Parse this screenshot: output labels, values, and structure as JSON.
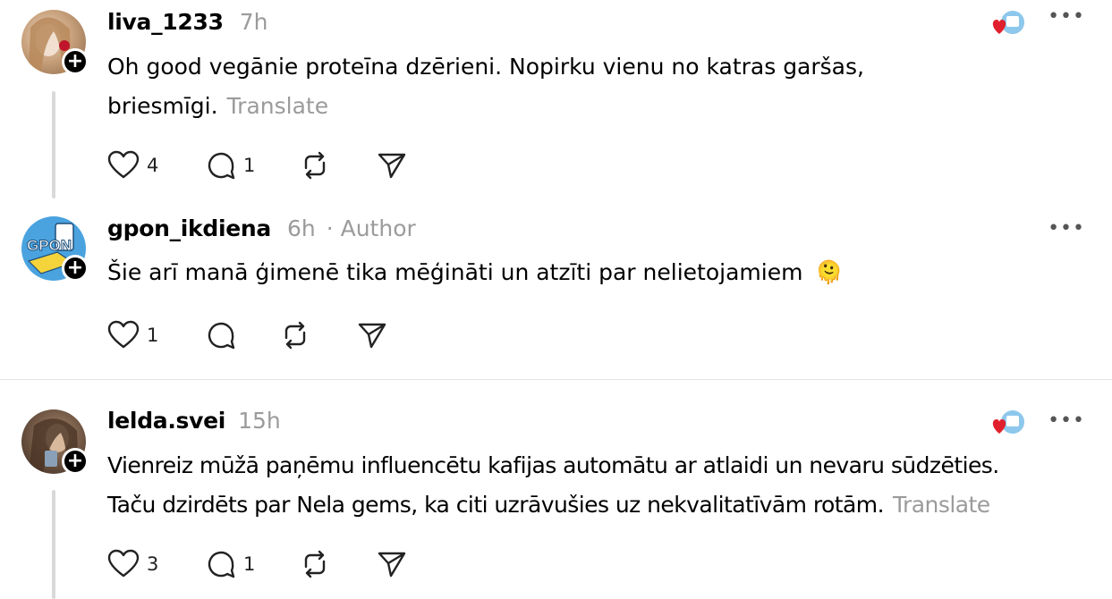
{
  "posts": [
    {
      "username": "liva_1233",
      "time": "7h",
      "text_line1": "Oh good vegānie proteīna dzērieni. Nopirku vienu no katras garšas,",
      "text_line2": "briesmīgi.",
      "translate": "Translate",
      "likes": "4",
      "replies": "1"
    },
    {
      "username": "gpon_ikdiena",
      "time": "6h",
      "author_label": "· Author",
      "text_line1": "Šie arī manā ģimenē tika mēģināti un atzīti par nelietojamiem",
      "emoji": "🫠",
      "avatar_text": "GPON",
      "likes": "1"
    },
    {
      "username": "lelda.svei",
      "time": "15h",
      "text_line1": "Vienreiz mūžā paņēmu influencētu kafijas automātu ar atlaidi un nevaru sūdzēties.",
      "text_line2": "Taču dzirdēts par Nela gems, ka citi uzrāvušies uz nekvalitatīvām rotām.",
      "translate": "Translate",
      "likes": "3",
      "replies": "1"
    }
  ],
  "colors": {
    "muted_text": "#9b9b9b",
    "thread_line": "#d9d9d9",
    "heart_red": "#e0202c"
  }
}
